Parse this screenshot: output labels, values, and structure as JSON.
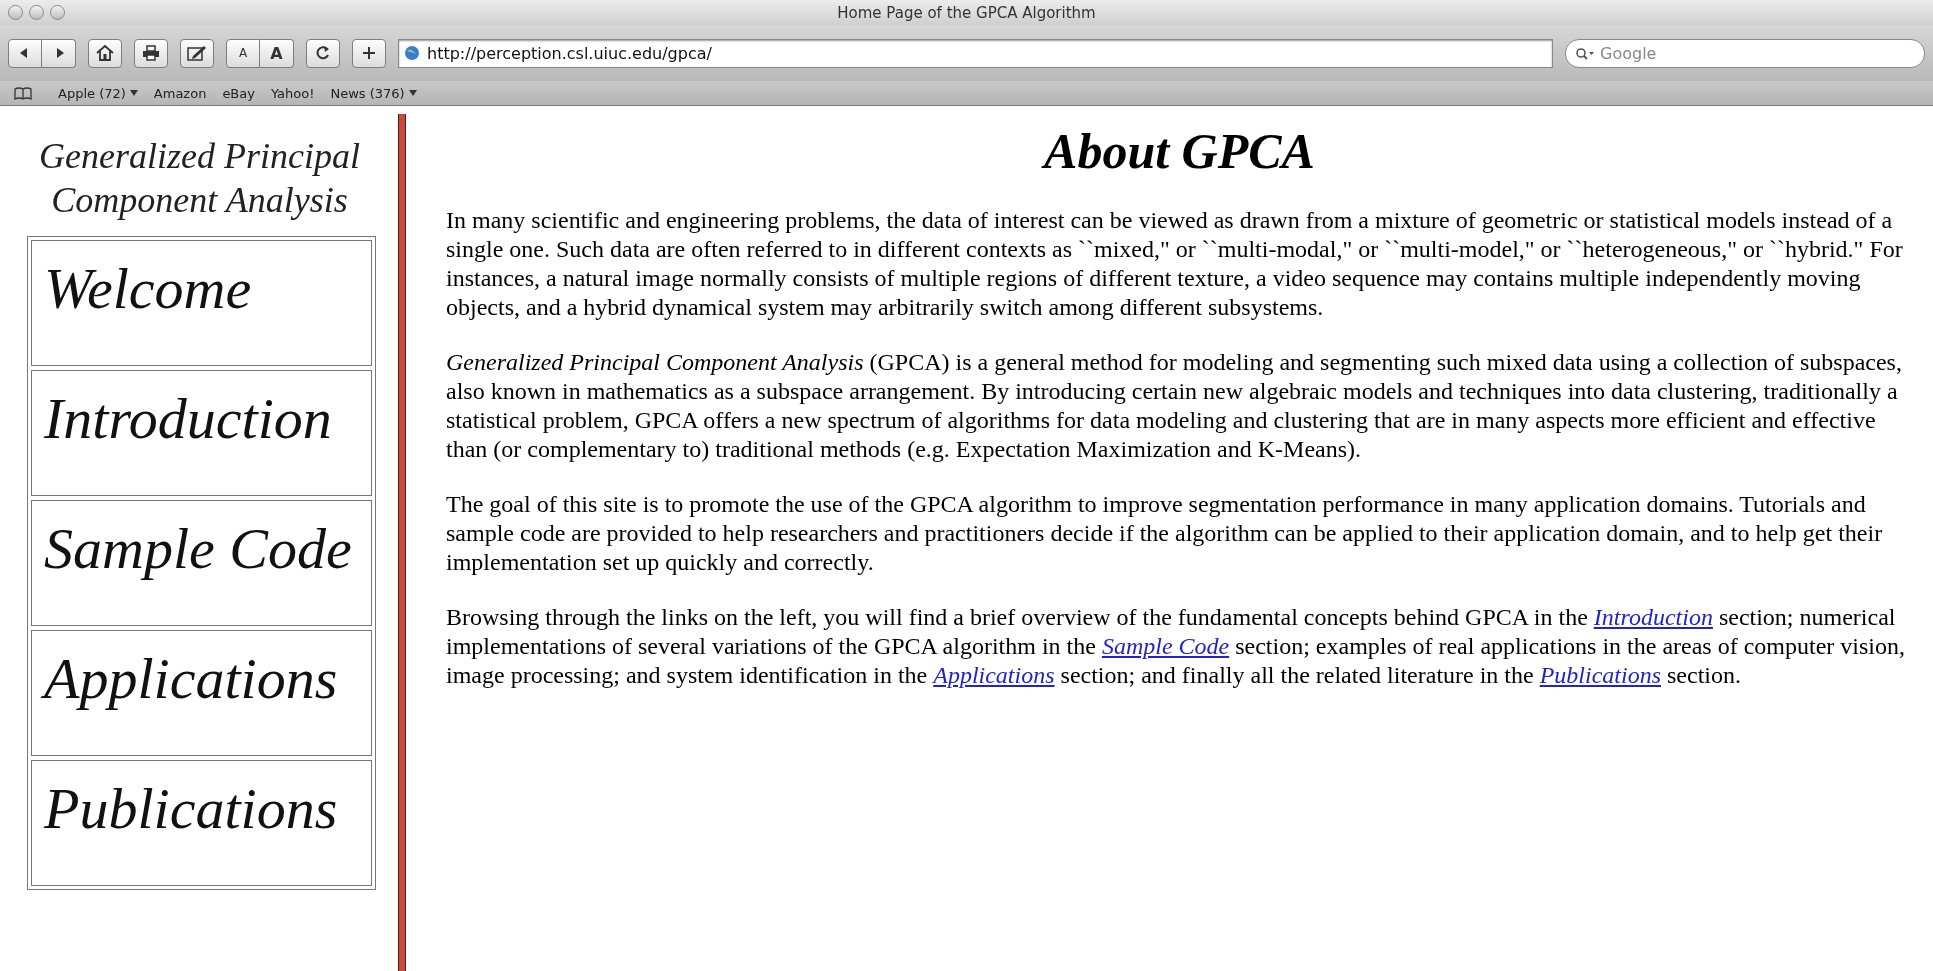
{
  "window": {
    "title": "Home Page of the GPCA Algorithm"
  },
  "toolbar": {
    "text_size_buttons": [
      "A",
      "A"
    ],
    "address": "http://perception.csl.uiuc.edu/gpca/",
    "search": {
      "placeholder": "Google"
    }
  },
  "bookmarks": [
    {
      "label": "Apple (72)",
      "menu": true
    },
    {
      "label": "Amazon",
      "menu": false
    },
    {
      "label": "eBay",
      "menu": false
    },
    {
      "label": "Yahoo!",
      "menu": false
    },
    {
      "label": "News (376)",
      "menu": true
    }
  ],
  "sidebar": {
    "logo": [
      "Generalized Principal",
      "Component Analysis"
    ],
    "items": [
      "Welcome",
      "Introduction",
      "Sample Code",
      "Applications",
      "Publications"
    ]
  },
  "main": {
    "heading": "About GPCA",
    "paragraphs": [
      [
        {
          "text": "In many scientific and engineering problems, the data of interest can be viewed as drawn from a mixture of geometric or statistical models instead of a single one. Such data are often referred to in different contexts as ``mixed,\" or ``multi-modal,\" or ``multi-model,\" or ``heterogeneous,\" or ``hybrid.\" For instances, a natural image normally consists of multiple regions of different texture, a video sequence may contains multiple independently moving objects, and a hybrid dynamical system may arbitrarily switch among different subsystems."
        }
      ],
      [
        {
          "text": "*Generalized Principal Component Analysis* (GPCA) is a general method for modeling and segmenting such mixed data using a collection of subspaces, also known in mathematics as a subspace arrangement. By introducing certain new algebraic models and techniques into data clustering, traditionally a statistical problem, GPCA offers a new spectrum of algorithms for data modeling and clustering that are in many aspects more efficient and effective than (or complementary to) traditional methods (e.g. Expectation Maximization and K-Means)."
        }
      ],
      [
        {
          "text": "The goal of this site is to promote the use of the GPCA algorithm to improve segmentation performance in many application domains. Tutorials and sample code are provided to help researchers and practitioners decide if the algorithm can be applied to their application domain, and to help get their implementation set up quickly and correctly."
        }
      ],
      [
        {
          "text": "Browsing through the links on the left, you will find a brief overview of the fundamental concepts behind GPCA in the"
        },
        {
          "link": "Introduction"
        },
        {
          "text": "section; numerical implementations of several variations of the GPCA algorithm in the"
        },
        {
          "link": "Sample Code"
        },
        {
          "text": "section; examples of real applications in the areas of computer vision, image processing; and system identification in the"
        },
        {
          "link": "Applications"
        },
        {
          "text": "section; and finally all the related literature in the"
        },
        {
          "link": "Publications"
        },
        {
          "text": "section."
        }
      ]
    ]
  }
}
